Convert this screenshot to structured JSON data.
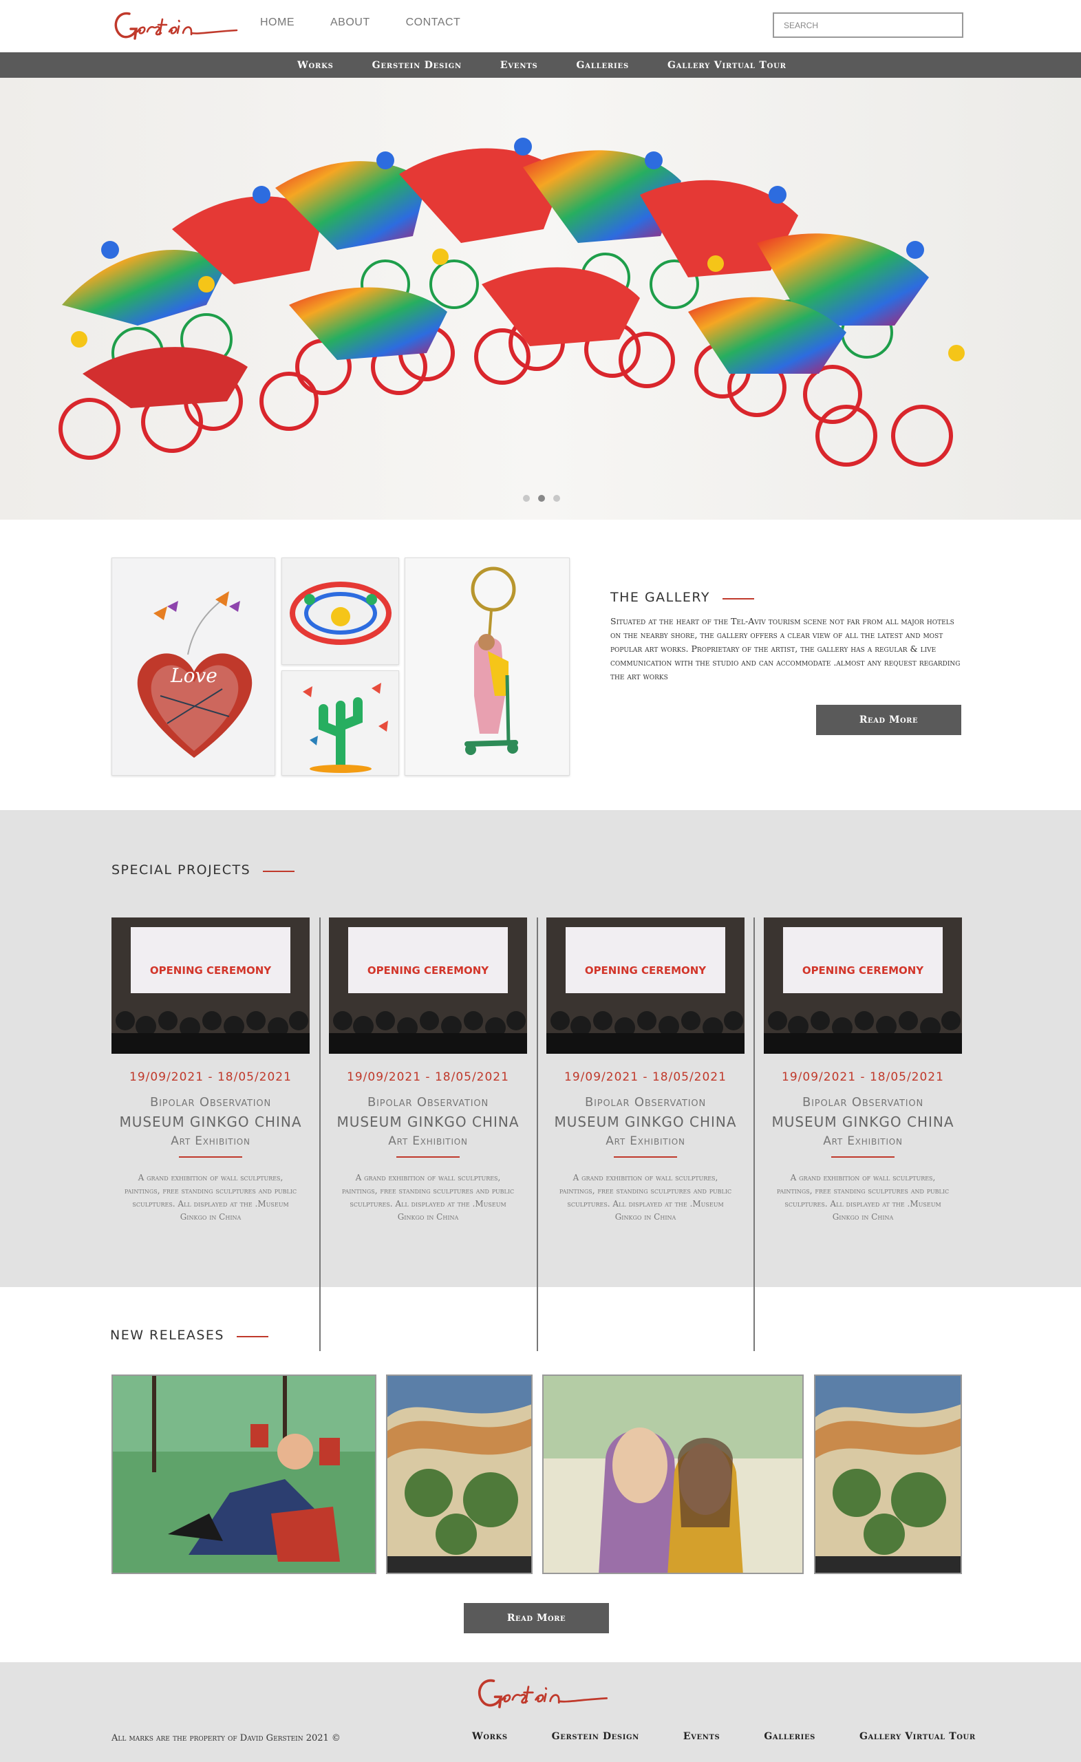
{
  "header": {
    "logo_text": "Gerstein",
    "nav": [
      "HOME",
      "ABOUT",
      "CONTACT"
    ],
    "search_placeholder": "SEARCH"
  },
  "subnav": [
    "Works",
    "Gerstein Design",
    "Events",
    "Galleries",
    "Gallery Virtual Tour"
  ],
  "hero": {
    "slides": 3,
    "active_slide": 2
  },
  "gallery": {
    "title": "THE GALLERY",
    "text": "Situated at the heart of the Tel-Aviv tourism scene not far from all major hotels on the nearby shore, the gallery offers a clear view of all the latest and most popular art works. Proprietary of the artist, the gallery has a regular & live communication with the studio and can accommodate .almost any request regarding the art works",
    "button": "Read More",
    "thumb_heart_text": "Love"
  },
  "special_projects": {
    "title": "SPECIAL PROJECTS",
    "cards": [
      {
        "date": "19/09/2021 - 18/05/2021",
        "line1": "Bipolar Observation",
        "line2": "MUSEUM GINKGO CHINA",
        "line3": "Art Exhibition",
        "desc": "A grand exhibition of wall sculptures, paintings, free standing sculptures and public sculptures. All displayed at the .Museum Ginkgo in China",
        "banner": "OPENING CEREMONY"
      },
      {
        "date": "19/09/2021 - 18/05/2021",
        "line1": "Bipolar Observation",
        "line2": "MUSEUM GINKGO CHINA",
        "line3": "Art Exhibition",
        "desc": "A grand exhibition of wall sculptures, paintings, free standing sculptures and public sculptures. All displayed at the .Museum Ginkgo in China",
        "banner": "OPENING CEREMONY"
      },
      {
        "date": "19/09/2021 - 18/05/2021",
        "line1": "Bipolar Observation",
        "line2": "MUSEUM GINKGO CHINA",
        "line3": "Art Exhibition",
        "desc": "A grand exhibition of wall sculptures, paintings, free standing sculptures and public sculptures. All displayed at the .Museum Ginkgo in China",
        "banner": "OPENING CEREMONY"
      },
      {
        "date": "19/09/2021 - 18/05/2021",
        "line1": "Bipolar Observation",
        "line2": "MUSEUM GINKGO CHINA",
        "line3": "Art Exhibition",
        "desc": "A grand exhibition of wall sculptures, paintings, free standing sculptures and public sculptures. All displayed at the .Museum Ginkgo in China",
        "banner": "OPENING CEREMONY"
      }
    ]
  },
  "new_releases": {
    "title": "NEW RELEASES",
    "button": "Read More"
  },
  "footer": {
    "logo_text": "Gerstein",
    "copyright": "All marks are the property of David Gerstein 2021 ©",
    "nav": [
      "Works",
      "Gerstein Design",
      "Events",
      "Galleries",
      "Gallery Virtual Tour"
    ]
  },
  "colors": {
    "accent": "#c0392b",
    "nav_bar": "#5a5a5a",
    "section_bg": "#e2e2e2"
  }
}
